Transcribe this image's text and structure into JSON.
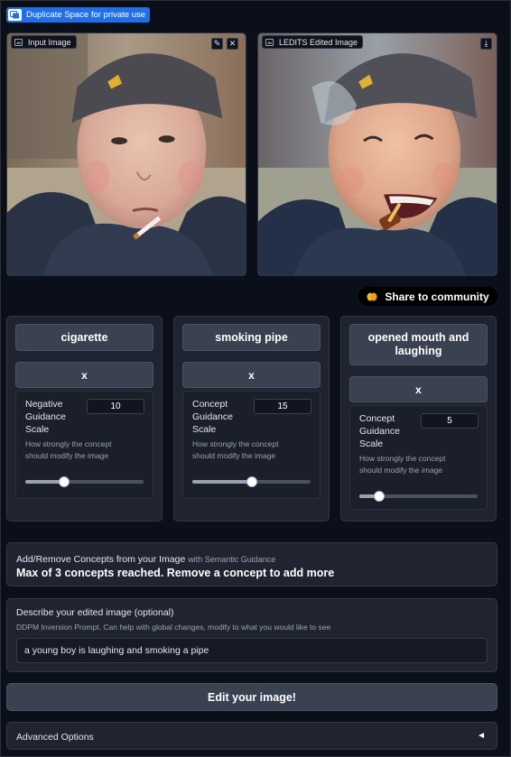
{
  "badge": {
    "label": "Duplicate Space for private use",
    "icon": "duplicate-icon"
  },
  "input_image": {
    "label": "Input Image",
    "tools": [
      "edit-icon",
      "close-icon"
    ]
  },
  "edited_image": {
    "label": "LEDITS Edited Image",
    "tools": [
      "download-icon"
    ]
  },
  "share": {
    "label": "Share to community",
    "icon": "hands-icon"
  },
  "concepts": [
    {
      "name": "cigarette",
      "remove_label": "x",
      "slider_label": "Negative Guidance Scale",
      "value": "10",
      "info": "How strongly the concept should modify the image",
      "level": 0.33
    },
    {
      "name": "smoking pipe",
      "remove_label": "x",
      "slider_label": "Concept Guidance Scale",
      "value": "15",
      "info": "How strongly the concept should modify the image",
      "level": 0.5
    },
    {
      "name": "opened mouth and laughing",
      "remove_label": "x",
      "slider_label": "Concept Guidance Scale",
      "value": "5",
      "info": "How strongly the concept should modify the image",
      "level": 0.17
    }
  ],
  "add_section": {
    "title": "Add/Remove Concepts from your Image",
    "subtitle": "with Semantic Guidance",
    "message": "Max of 3 concepts reached. Remove a concept to add more"
  },
  "describe": {
    "title": "Describe your edited image (optional)",
    "info": "DDPM Inversion Prompt. Can help with global changes, modify to what you would like to see",
    "value": "a young boy is laughing and smoking a pipe"
  },
  "edit_button": "Edit your image!",
  "advanced": {
    "label": "Advanced Options",
    "arrow": "◄"
  }
}
